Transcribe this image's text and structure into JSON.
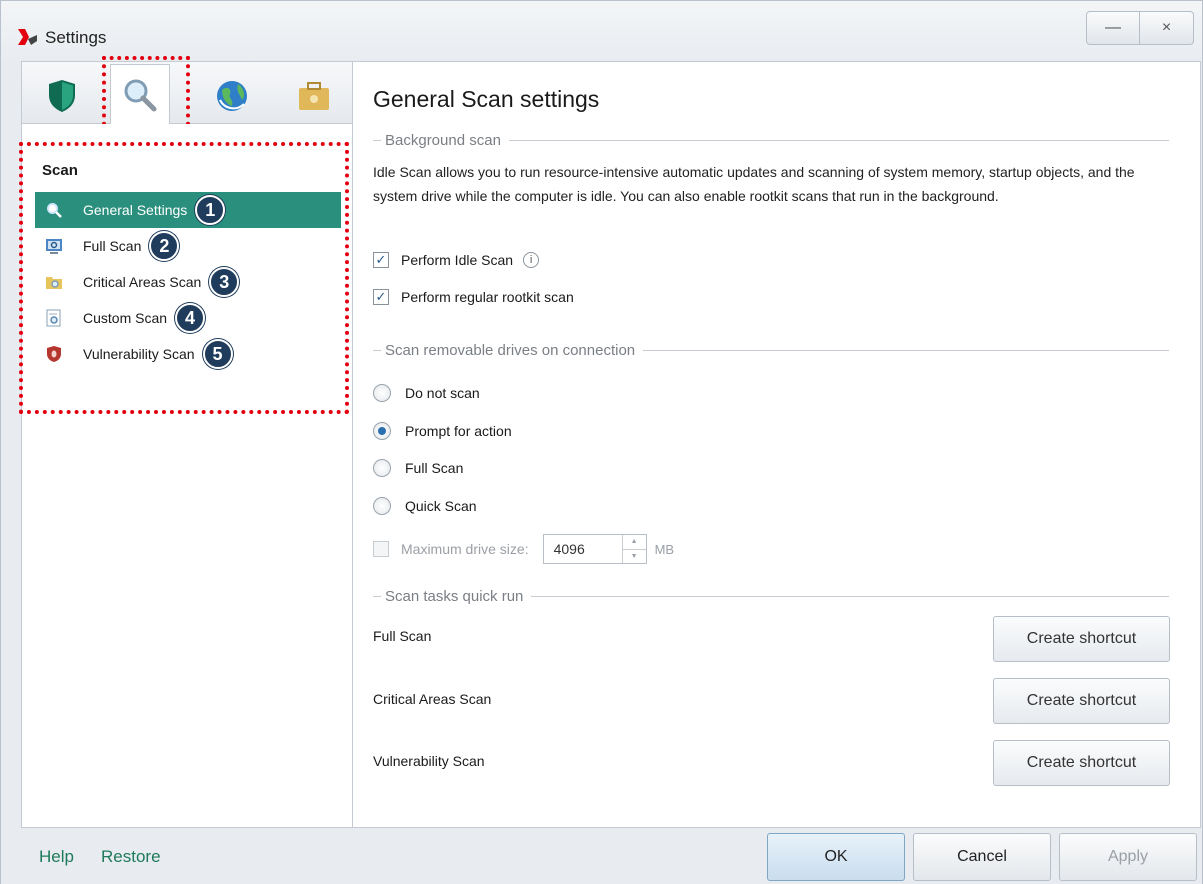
{
  "window": {
    "title": "Settings",
    "minimize_label": "—",
    "close_label": "×"
  },
  "tabs": [
    {
      "icon": "shield-icon",
      "active": false
    },
    {
      "icon": "magnifier-icon",
      "active": true
    },
    {
      "icon": "globe-icon",
      "active": false
    },
    {
      "icon": "briefcase-icon",
      "active": false
    }
  ],
  "sidebar": {
    "heading": "Scan",
    "items": [
      {
        "label": "General Settings",
        "badge": "1",
        "icon": "magnifier-icon",
        "active": true
      },
      {
        "label": "Full Scan",
        "badge": "2",
        "icon": "monitor-scan-icon",
        "active": false
      },
      {
        "label": "Critical Areas Scan",
        "badge": "3",
        "icon": "folder-scan-icon",
        "active": false
      },
      {
        "label": "Custom Scan",
        "badge": "4",
        "icon": "document-scan-icon",
        "active": false
      },
      {
        "label": "Vulnerability Scan",
        "badge": "5",
        "icon": "shield-bug-icon",
        "active": false
      }
    ]
  },
  "main": {
    "title": "General Scan settings",
    "background_scan": {
      "section_label": "Background scan",
      "description": "Idle Scan allows you to run resource-intensive automatic updates and scanning of system memory, startup objects, and the system drive while the computer is idle. You can also enable rootkit scans that run in the background.",
      "idle_scan_label": "Perform Idle Scan",
      "idle_scan_checked": true,
      "rootkit_label": "Perform regular rootkit scan",
      "rootkit_checked": true
    },
    "removable": {
      "section_label": "Scan removable drives on connection",
      "options": [
        {
          "label": "Do not scan",
          "checked": false
        },
        {
          "label": "Prompt for action",
          "checked": true
        },
        {
          "label": "Full Scan",
          "checked": false
        },
        {
          "label": "Quick Scan",
          "checked": false
        }
      ],
      "max_size_label": "Maximum drive size:",
      "max_size_checked": false,
      "max_size_value": "4096",
      "max_size_unit": "MB"
    },
    "quick_run": {
      "section_label": "Scan tasks quick run",
      "tasks": [
        {
          "label": "Full Scan",
          "button": "Create shortcut"
        },
        {
          "label": "Critical Areas Scan",
          "button": "Create shortcut"
        },
        {
          "label": "Vulnerability Scan",
          "button": "Create shortcut"
        }
      ]
    }
  },
  "footer": {
    "help": "Help",
    "restore": "Restore",
    "ok": "OK",
    "cancel": "Cancel",
    "apply": "Apply"
  },
  "colors": {
    "accent": "#2a8f7c",
    "highlight_dots": "#e3000f",
    "badge": "#1f3c5c"
  }
}
